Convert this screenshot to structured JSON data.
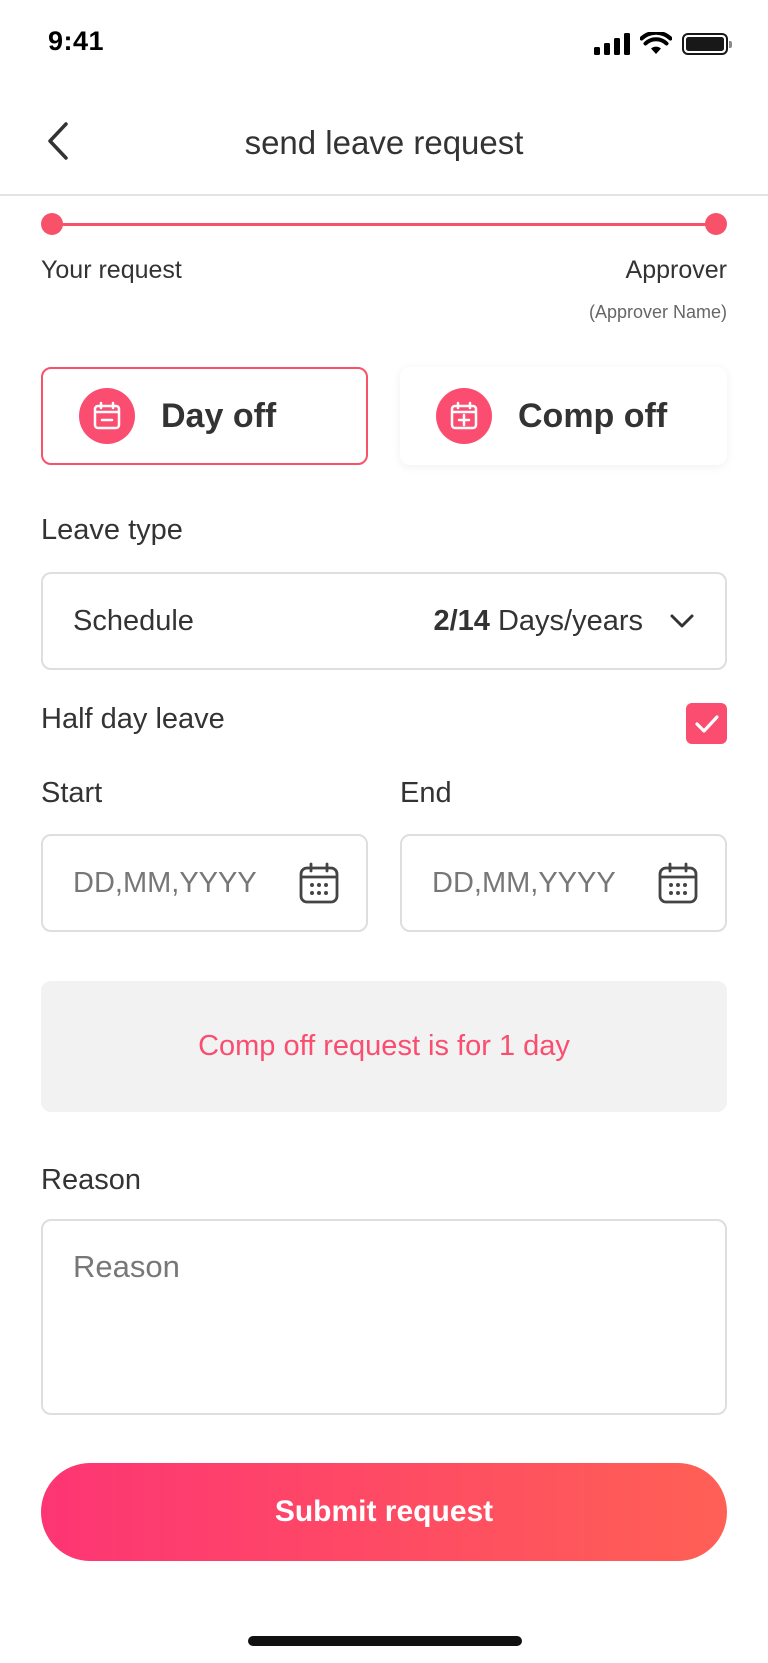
{
  "status_bar": {
    "time": "9:41"
  },
  "header": {
    "title": "send leave request"
  },
  "stepper": {
    "left_label": "Your request",
    "right_label": "Approver",
    "approver_name": "(Approver Name)"
  },
  "leave_options": [
    {
      "label": "Day off",
      "selected": true,
      "icon": "calendar-minus-icon"
    },
    {
      "label": "Comp off",
      "selected": false,
      "icon": "calendar-plus-icon"
    }
  ],
  "leave_type": {
    "label": "Leave type",
    "selected_value": "Schedule",
    "quota": "2/14",
    "quota_unit": "Days/years"
  },
  "half_day": {
    "label": "Half day leave",
    "checked": true
  },
  "dates": {
    "start_label": "Start",
    "end_label": "End",
    "start_placeholder": "DD,MM,YYYY",
    "end_placeholder": "DD,MM,YYYY"
  },
  "info": {
    "message": "Comp off request is for 1 day"
  },
  "reason": {
    "label": "Reason",
    "placeholder": "Reason"
  },
  "submit": {
    "label": "Submit request"
  },
  "colors": {
    "accent": "#fa4d6f",
    "gradient_start": "#fd3574",
    "gradient_end": "#ff6055"
  }
}
